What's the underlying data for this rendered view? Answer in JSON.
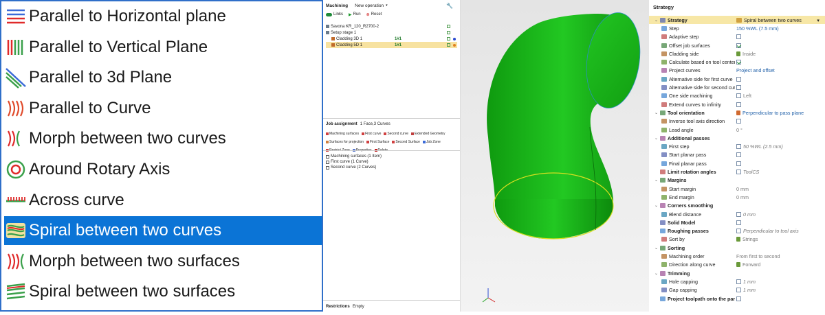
{
  "strategy_list": {
    "items": [
      {
        "label": "Parallel to Horizontal plane",
        "icon": "horizontal-lines-icon",
        "selected": false
      },
      {
        "label": "Parallel to Vertical Plane",
        "icon": "vertical-lines-icon",
        "selected": false
      },
      {
        "label": "Parallel to 3d Plane",
        "icon": "diagonal-lines-icon",
        "selected": false
      },
      {
        "label": "Parallel to Curve",
        "icon": "curve-lines-icon",
        "selected": false
      },
      {
        "label": "Morph between two curves",
        "icon": "morph-curves-icon",
        "selected": false
      },
      {
        "label": "Around Rotary Axis",
        "icon": "rotary-axis-icon",
        "selected": false
      },
      {
        "label": "Across curve",
        "icon": "across-curve-icon",
        "selected": false
      },
      {
        "label": "Spiral between two curves",
        "icon": "spiral-curves-icon",
        "selected": true
      },
      {
        "label": "Morph between two surfaces",
        "icon": "morph-surfaces-icon",
        "selected": false
      },
      {
        "label": "Spiral between two surfaces",
        "icon": "spiral-surfaces-icon",
        "selected": false
      }
    ]
  },
  "machining_panel": {
    "tab_label": "Machining",
    "new_operation_label": "New operation",
    "links_label": "Links",
    "run_label": "Run",
    "reset_label": "Reset",
    "tree": [
      {
        "label": "Savona KR_120_R2700-2",
        "value": ""
      },
      {
        "label": "Setup stage 1",
        "value": ""
      },
      {
        "label": "Cladding 3D 1",
        "value": "1#1"
      },
      {
        "label": "Cladding 5D 1",
        "value": "1#1"
      }
    ],
    "job_assignment_label": "Job assignment",
    "job_assignment_value": "1 Face,3 Curves",
    "job_buttons": [
      "Machining surfaces",
      "First curve",
      "Second curve",
      "Extended Geometry",
      "Surfaces for projection",
      "First Surface",
      "Second Surface",
      "Job Zone",
      "Restrict Zone",
      "Properties",
      "Delete"
    ],
    "job_tree": [
      "Machining surfaces (1 Item)",
      "First curve (1 Curve)",
      "Second curve (2 Curves)"
    ],
    "restrictions_label": "Restrictions",
    "restrictions_value": "Empty"
  },
  "properties": {
    "header": "Strategy",
    "rows": [
      {
        "label": "Strategy",
        "value": "Spiral between two curves",
        "kind": "section-selected",
        "indent": 0
      },
      {
        "label": "Step",
        "value": "150 %WL (7.5 mm)",
        "kind": "text-blue",
        "indent": 1
      },
      {
        "label": "Adaptive step",
        "value": "",
        "kind": "check",
        "checked": false,
        "indent": 1
      },
      {
        "label": "Offset job surfaces",
        "value": "",
        "kind": "check",
        "checked": true,
        "indent": 1
      },
      {
        "label": "Cladding side",
        "value": "Inside",
        "kind": "text-grey-icon",
        "indent": 1
      },
      {
        "label": "Calculate based on tool center",
        "value": "",
        "kind": "check",
        "checked": true,
        "indent": 1
      },
      {
        "label": "Project curves",
        "value": "Project and offset",
        "kind": "text-blue",
        "indent": 1
      },
      {
        "label": "Alternative side for first curve",
        "value": "",
        "kind": "check",
        "checked": false,
        "indent": 1
      },
      {
        "label": "Alternative side for second curve",
        "value": "",
        "kind": "check",
        "checked": false,
        "indent": 1
      },
      {
        "label": "One side machining",
        "value": "Left",
        "kind": "check-text",
        "checked": false,
        "indent": 1
      },
      {
        "label": "Extend curves to infinity",
        "value": "",
        "kind": "check",
        "checked": false,
        "indent": 1
      },
      {
        "label": "Tool orientation",
        "value": "Perpendicular to pass plane",
        "kind": "section-blue",
        "indent": 0
      },
      {
        "label": "Inverse tool axis direction",
        "value": "",
        "kind": "check",
        "checked": false,
        "indent": 1
      },
      {
        "label": "Lead angle",
        "value": "0 °",
        "kind": "text-grey",
        "indent": 1
      },
      {
        "label": "Additional passes",
        "value": "",
        "kind": "section",
        "indent": 0
      },
      {
        "label": "First step",
        "value": "50 %WL (2.5 mm)",
        "kind": "check-italic",
        "checked": false,
        "indent": 1
      },
      {
        "label": "Start planar pass",
        "value": "",
        "kind": "check",
        "checked": false,
        "indent": 1
      },
      {
        "label": "Final planar pass",
        "value": "",
        "kind": "check",
        "checked": false,
        "indent": 1
      },
      {
        "label": "Limit rotation angles",
        "value": "ToolCS",
        "kind": "section-check-italic",
        "checked": false,
        "indent": 0
      },
      {
        "label": "Margins",
        "value": "",
        "kind": "section",
        "indent": 0
      },
      {
        "label": "Start margin",
        "value": "0 mm",
        "kind": "text-grey",
        "indent": 1
      },
      {
        "label": "End margin",
        "value": "0 mm",
        "kind": "text-grey",
        "indent": 1
      },
      {
        "label": "Corners smoothing",
        "value": "",
        "kind": "section",
        "indent": 0
      },
      {
        "label": "Blend distance",
        "value": "0 mm",
        "kind": "check-italic",
        "checked": false,
        "indent": 1
      },
      {
        "label": "Solid Model",
        "value": "",
        "kind": "section-check",
        "checked": false,
        "indent": 0
      },
      {
        "label": "Roughing passes",
        "value": "Perpendicular to tool axis",
        "kind": "section-check-italic",
        "checked": false,
        "indent": 0
      },
      {
        "label": "Sort by",
        "value": "Strings",
        "kind": "text-grey-icon",
        "indent": 1
      },
      {
        "label": "Sorting",
        "value": "",
        "kind": "section",
        "indent": 0
      },
      {
        "label": "Machining order",
        "value": "From first to second",
        "kind": "text-grey",
        "indent": 1
      },
      {
        "label": "Direction along curve",
        "value": "Forward",
        "kind": "text-grey-icon",
        "indent": 1
      },
      {
        "label": "Trimming",
        "value": "",
        "kind": "section",
        "indent": 0
      },
      {
        "label": "Hole capping",
        "value": "1 mm",
        "kind": "check-italic",
        "checked": false,
        "indent": 1
      },
      {
        "label": "Gap capping",
        "value": "1 mm",
        "kind": "check-italic",
        "checked": false,
        "indent": 1
      },
      {
        "label": "Project toolpath onto the part",
        "value": "",
        "kind": "section-check",
        "checked": false,
        "indent": 0
      }
    ]
  },
  "colors": {
    "selection": "#0b74d6",
    "model_green": "#1fbf1f",
    "accent": "#1f5fa8",
    "prop_selected": "#f7e7a6"
  }
}
